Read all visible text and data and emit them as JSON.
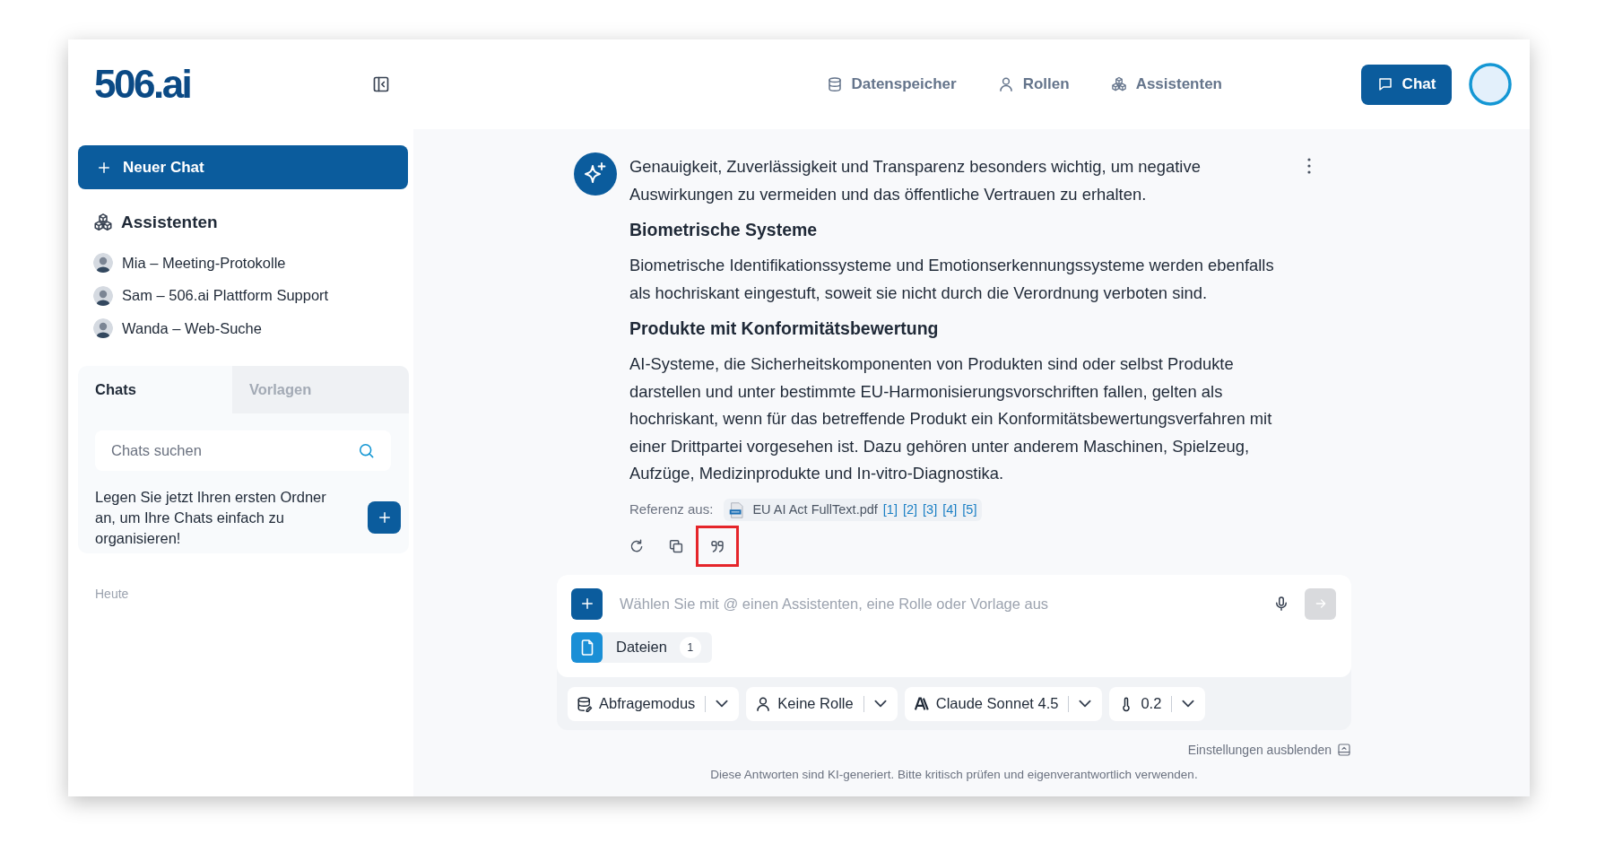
{
  "header": {
    "logo": "506.ai",
    "nav": [
      {
        "kind": "database",
        "label": "Datenspeicher"
      },
      {
        "kind": "person",
        "label": "Rollen"
      },
      {
        "kind": "cubes",
        "label": "Assistenten"
      }
    ],
    "chat_button": "Chat"
  },
  "sidebar": {
    "new_chat": "Neuer Chat",
    "assistants_title": "Assistenten",
    "assistants": [
      {
        "name": "Mia – Meeting-Protokolle"
      },
      {
        "name": "Sam – 506.ai Plattform Support"
      },
      {
        "name": "Wanda – Web-Suche"
      }
    ],
    "tabs": [
      {
        "label": "Chats",
        "selected": true
      },
      {
        "label": "Vorlagen",
        "selected": false
      }
    ],
    "search": {
      "placeholder": "Chats suchen"
    },
    "folder_hint": "Legen Sie jetzt Ihren ersten Ordner an, um Ihre Chats einfach zu organisieren!",
    "group_label": "Heute"
  },
  "message": {
    "blocks": [
      {
        "kind": "paragraph",
        "text": "Genauigkeit, Zuverlässigkeit und Transparenz besonders wichtig, um negative Auswirkungen zu vermeiden und das öffentliche Vertrauen zu erhalten."
      },
      {
        "kind": "heading",
        "text": "Biometrische Systeme"
      },
      {
        "kind": "paragraph",
        "text": "Biometrische Identifikationssysteme und Emotionserkennungssysteme werden ebenfalls als hochriskant eingestuft, soweit sie nicht durch die Verordnung verboten sind."
      },
      {
        "kind": "heading",
        "text": "Produkte mit Konformitätsbewertung"
      },
      {
        "kind": "paragraph",
        "text": "AI-Systeme, die Sicherheitskomponenten von Produkten sind oder selbst Produkte darstellen und unter bestimmte EU-Harmonisierungsvorschriften fallen, gelten als hochriskant, wenn für das betreffende Produkt ein Konformitätsbewertungsverfahren mit einer Drittpartei vorgesehen ist. Dazu gehören unter anderem Maschinen, Spielzeug, Aufzüge, Medizinprodukte und In-vitro-Diagnostika."
      }
    ],
    "reference": {
      "label": "Referenz aus:",
      "file": "EU AI Act FullText.pdf",
      "citations": [
        "[1]",
        "[2]",
        "[3]",
        "[4]",
        "[5]"
      ]
    },
    "actions": [
      {
        "kind": "regenerate",
        "highlighted": false
      },
      {
        "kind": "copy",
        "highlighted": false
      },
      {
        "kind": "quote",
        "highlighted": true
      }
    ]
  },
  "composer": {
    "placeholder": "Wählen Sie mit @ einen Assistenten, eine Rolle oder Vorlage aus",
    "send_disabled": true,
    "attachments": [
      {
        "label": "Dateien",
        "count": "1"
      }
    ],
    "settings": [
      {
        "kind": "mode",
        "label": "Abfragemodus"
      },
      {
        "kind": "role",
        "label": "Keine Rolle"
      },
      {
        "kind": "model",
        "label": "Claude Sonnet 4.5"
      },
      {
        "kind": "temperature",
        "label": "0.2"
      }
    ],
    "hide_settings": "Einstellungen ausblenden"
  },
  "disclaimer": "Diese Antworten sind KI-generiert. Bitte kritisch prüfen und eigenverantwortlich verwenden."
}
